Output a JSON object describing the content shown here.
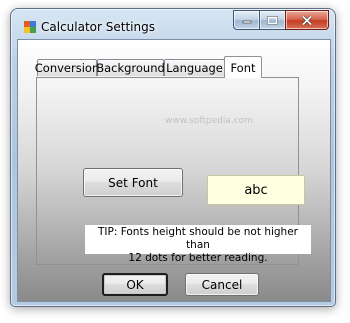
{
  "window": {
    "title": "Calculator Settings",
    "icons": {
      "app": "calculator-app-icon",
      "minimize": "minimize-icon",
      "maximize": "maximize-icon",
      "close": "close-icon"
    }
  },
  "tabs": [
    {
      "label": "Conversion",
      "active": false
    },
    {
      "label": "Background",
      "active": false
    },
    {
      "label": "Language",
      "active": false
    },
    {
      "label": "Font",
      "active": true
    }
  ],
  "watermark": "www.softpedia.com",
  "font_tab": {
    "set_font_label": "Set Font",
    "preview_text": "abc",
    "tip_line1": "TIP: Fonts height should be not higher than",
    "tip_line2": "12 dots for better reading."
  },
  "footer": {
    "ok_label": "OK",
    "cancel_label": "Cancel"
  },
  "colors": {
    "preview_bg": "#ffffe1",
    "close_button": "#c43c22"
  }
}
